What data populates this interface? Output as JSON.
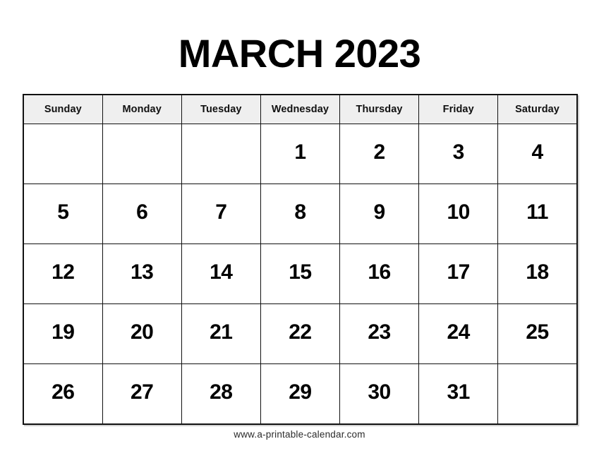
{
  "document": {
    "title": "MARCH 2023",
    "month": "MARCH",
    "year": "2023"
  },
  "calendar": {
    "weekday_headers": [
      "Sunday",
      "Monday",
      "Tuesday",
      "Wednesday",
      "Thursday",
      "Friday",
      "Saturday"
    ],
    "weeks": [
      [
        "",
        "",
        "",
        "1",
        "2",
        "3",
        "4"
      ],
      [
        "5",
        "6",
        "7",
        "8",
        "9",
        "10",
        "11"
      ],
      [
        "12",
        "13",
        "14",
        "15",
        "16",
        "17",
        "18"
      ],
      [
        "19",
        "20",
        "21",
        "22",
        "23",
        "24",
        "25"
      ],
      [
        "26",
        "27",
        "28",
        "29",
        "30",
        "31",
        ""
      ]
    ]
  },
  "footer": {
    "url": "www.a-printable-calendar.com"
  },
  "colors": {
    "page_background": "#ffffff",
    "header_cell_background": "#efefef",
    "grid_line": "#111111",
    "text": "#000000",
    "footer_text": "#2b2b2b"
  }
}
